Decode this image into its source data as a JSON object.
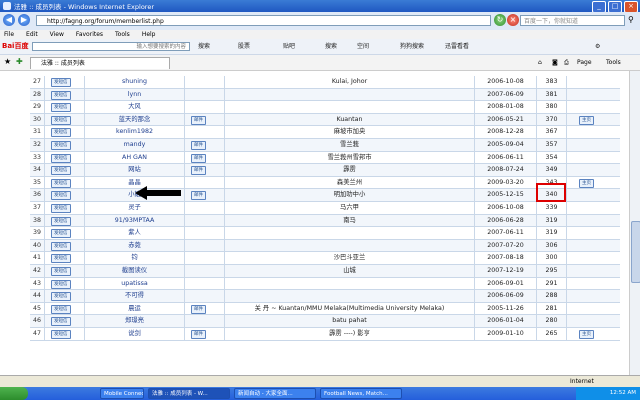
{
  "window": {
    "title": "法雅 :: 成员列表 - Windows Internet Explorer"
  },
  "address": {
    "url": "http://fagng.org/forum/memberlist.php",
    "search_placeholder": "百度一下，你就知道"
  },
  "menu": [
    "File",
    "Edit",
    "View",
    "Favorites",
    "Tools",
    "Help"
  ],
  "baidu": {
    "logo": "Bai百度",
    "input_placeholder": "输入想要搜索的内容",
    "buttons": [
      "搜索",
      "股票",
      "贴吧",
      "搜索",
      "空间",
      "狗狗搜索",
      "迅雷看看"
    ]
  },
  "tab": {
    "label": "法雅 :: 成员列表"
  },
  "commands": {
    "page": "Page",
    "tools": "Tools"
  },
  "pm_label": "发短信",
  "email_label": "邮件",
  "web_label": "主页",
  "members": [
    {
      "num": "27",
      "name": "shuning",
      "email": false,
      "location": "Kulai, Johor",
      "date": "2006-10-08",
      "posts": "383",
      "web": false
    },
    {
      "num": "28",
      "name": "lynn",
      "email": false,
      "location": "",
      "date": "2007-06-09",
      "posts": "381",
      "web": false
    },
    {
      "num": "29",
      "name": "大风",
      "email": false,
      "location": "",
      "date": "2008-01-08",
      "posts": "380",
      "web": false
    },
    {
      "num": "30",
      "name": "蓝天的那念",
      "email": true,
      "location": "Kuantan",
      "date": "2006-05-21",
      "posts": "370",
      "web": true
    },
    {
      "num": "31",
      "name": "kenlim1982",
      "email": false,
      "location": "麻坡市加央",
      "date": "2008-12-28",
      "posts": "367",
      "web": false
    },
    {
      "num": "32",
      "name": "mandy",
      "email": true,
      "location": "雪兰莪",
      "date": "2005-09-04",
      "posts": "357",
      "web": false
    },
    {
      "num": "33",
      "name": "AH GAN",
      "email": true,
      "location": "雪兰莪州雪邦市",
      "date": "2006-06-11",
      "posts": "354",
      "web": false
    },
    {
      "num": "34",
      "name": "网站",
      "email": true,
      "location": "霹雳",
      "date": "2008-07-24",
      "posts": "349",
      "web": false
    },
    {
      "num": "35",
      "name": "晶晶",
      "email": false,
      "location": "森美兰州",
      "date": "2009-03-20",
      "posts": "343",
      "web": true
    },
    {
      "num": "36",
      "name": "小娥",
      "email": true,
      "location": "明加叻中小",
      "date": "2005-12-15",
      "posts": "340",
      "web": false
    },
    {
      "num": "37",
      "name": "灵子",
      "email": false,
      "location": "马六甲",
      "date": "2006-10-08",
      "posts": "339",
      "web": false
    },
    {
      "num": "38",
      "name": "91/93MPTAA",
      "email": false,
      "location": "南马",
      "date": "2006-06-28",
      "posts": "319",
      "web": false
    },
    {
      "num": "39",
      "name": "紫人",
      "email": false,
      "location": "",
      "date": "2007-06-11",
      "posts": "319",
      "web": false
    },
    {
      "num": "40",
      "name": "赤菀",
      "email": false,
      "location": "",
      "date": "2007-07-20",
      "posts": "306",
      "web": false
    },
    {
      "num": "41",
      "name": "钧",
      "email": false,
      "location": "沙巴斗亚兰",
      "date": "2007-08-18",
      "posts": "300",
      "web": false
    },
    {
      "num": "42",
      "name": "截图读仪",
      "email": false,
      "location": "山城",
      "date": "2007-12-19",
      "posts": "295",
      "web": false
    },
    {
      "num": "43",
      "name": "upatissa",
      "email": false,
      "location": "",
      "date": "2006-09-01",
      "posts": "291",
      "web": false
    },
    {
      "num": "44",
      "name": "不可得",
      "email": false,
      "location": "",
      "date": "2006-06-09",
      "posts": "288",
      "web": false
    },
    {
      "num": "45",
      "name": "晨运",
      "email": true,
      "location": "关 丹 ~ Kuantan/MMU Melaka(Multimedia University Melaka)",
      "date": "2005-11-26",
      "posts": "281",
      "web": false
    },
    {
      "num": "46",
      "name": "郑璟亮",
      "email": false,
      "location": "batu pahat",
      "date": "2006-01-04",
      "posts": "280",
      "web": false
    },
    {
      "num": "47",
      "name": "说剑",
      "email": true,
      "location": "霹雳 ----) 影亨",
      "date": "2009-01-10",
      "posts": "265",
      "web": true
    }
  ],
  "status": {
    "zone": "Internet"
  },
  "taskbar": {
    "items": [
      "Mobile Connect",
      "法雅 :: 成员列表 - W...",
      "新闻自动 - 大家全面...",
      "Football News, Match..."
    ],
    "clock": "12:52 AM"
  }
}
